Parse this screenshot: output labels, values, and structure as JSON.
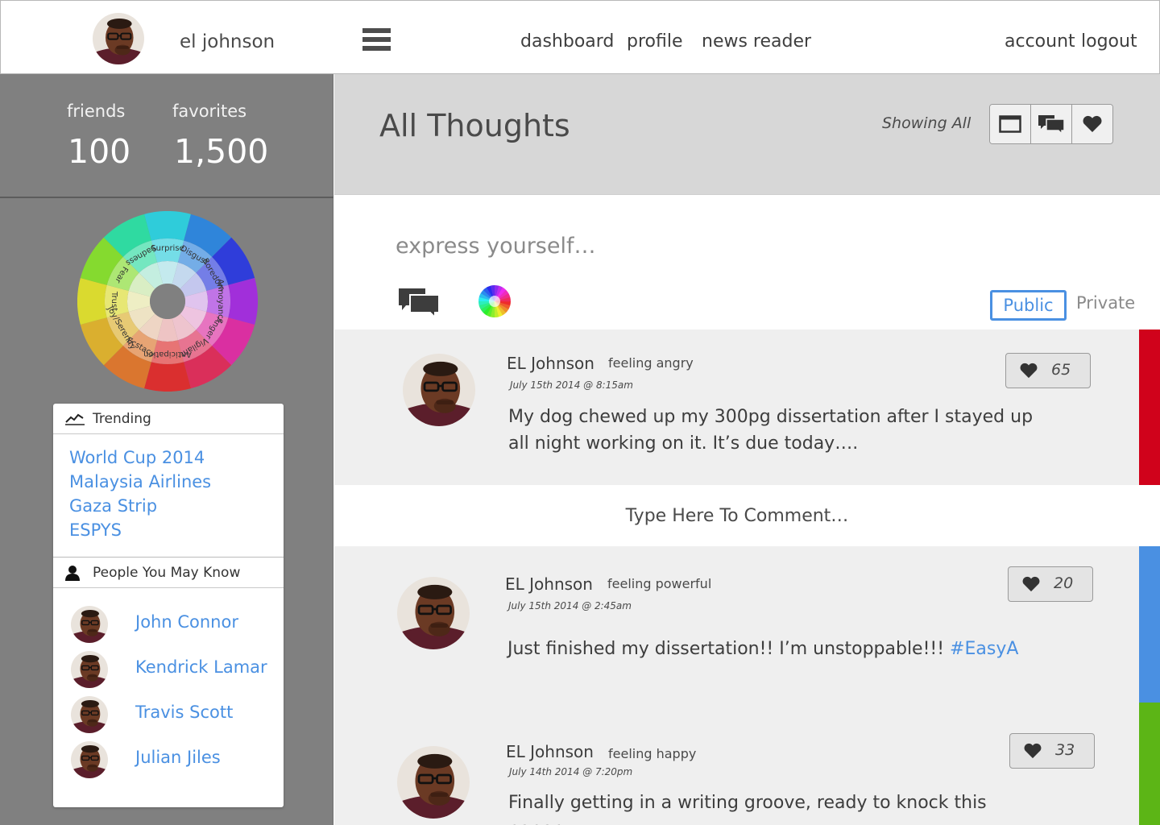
{
  "colors": {
    "accent": "#4a90e2",
    "sidebar_bg": "#808080",
    "post_bg": "#efefef",
    "mood_angry": "#d0021b",
    "mood_powerful": "#4a90e2",
    "mood_happy": "#5cb516"
  },
  "user": {
    "name": "el johnson"
  },
  "nav": {
    "menu_icon": "hamburger-icon",
    "links": [
      "dashboard",
      "profile",
      "news reader"
    ],
    "account": "account",
    "logout": "logout"
  },
  "stats": {
    "friends_label": "friends",
    "friends_value": "100",
    "favorites_label": "favorites",
    "favorites_value": "1,500"
  },
  "emotion_wheel": {
    "labels": [
      "Surprise",
      "Disgust",
      "Boredom",
      "Annoyance",
      "Anger",
      "Vigilant",
      "Anticipation",
      "Ecstacy",
      "Joy/Serenity",
      "Trust",
      "Fear",
      "Sadness"
    ]
  },
  "trending": {
    "title": "Trending",
    "icon": "trend-line-icon",
    "items": [
      "World Cup 2014",
      "Malaysia Airlines",
      "Gaza Strip",
      "ESPYS"
    ]
  },
  "people": {
    "title": "People You May Know",
    "icon": "person-icon",
    "items": [
      "John Connor",
      "Kendrick Lamar",
      "Travis Scott",
      "Julian Jiles"
    ]
  },
  "main": {
    "title": "All Thoughts",
    "filter_status": "Showing All",
    "view_toggles": [
      "single-view-icon",
      "conversation-icon",
      "heart-icon"
    ]
  },
  "composer": {
    "placeholder": "express yourself…",
    "public_label": "Public",
    "private_label": "Private"
  },
  "posts": [
    {
      "author": "EL Johnson",
      "feeling": "feeling angry",
      "timestamp": "July 15th 2014 @ 8:15am",
      "text": "My dog chewed up my 300pg dissertation after I stayed up all night working on it. It’s due today….",
      "likes": "65",
      "mood_color": "#d0021b"
    },
    {
      "author": "EL Johnson",
      "feeling": "feeling powerful",
      "timestamp": "July 15th 2014 @ 2:45am",
      "text": "Just finished my dissertation!! I’m unstoppable!!! ",
      "hashtag": "#EasyA",
      "likes": "20",
      "mood_color": "#4a90e2"
    },
    {
      "author": "EL Johnson",
      "feeling": "feeling happy",
      "timestamp": "July 14th 2014 @ 7:20pm",
      "text": "Finally getting in a writing groove, ready to knock this paper",
      "likes": "33",
      "mood_color": "#5cb516"
    }
  ],
  "comment": {
    "placeholder": "Type Here To Comment…"
  }
}
